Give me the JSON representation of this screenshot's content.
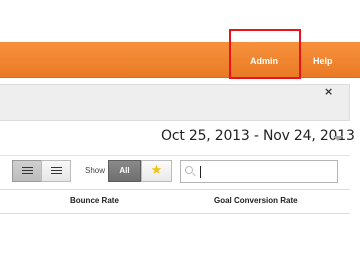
{
  "header": {
    "nav": [
      {
        "label": "Admin"
      },
      {
        "label": "Help"
      }
    ],
    "colors": {
      "bar": "#f08a33",
      "highlight": "#e8141c"
    }
  },
  "notice": {
    "close_glyph": "×"
  },
  "date_range": {
    "label": "Oct 25, 2013 - Nov 24, 2013"
  },
  "toolbar": {
    "view_buttons": [
      {
        "icon": "table-view-icon"
      },
      {
        "icon": "list-view-icon"
      }
    ],
    "show_label": "Show",
    "all_label": "All",
    "star_glyph": "★",
    "search": {
      "value": "",
      "placeholder": ""
    }
  },
  "table": {
    "columns": [
      "Bounce Rate",
      "Goal Conversion Rate"
    ]
  }
}
